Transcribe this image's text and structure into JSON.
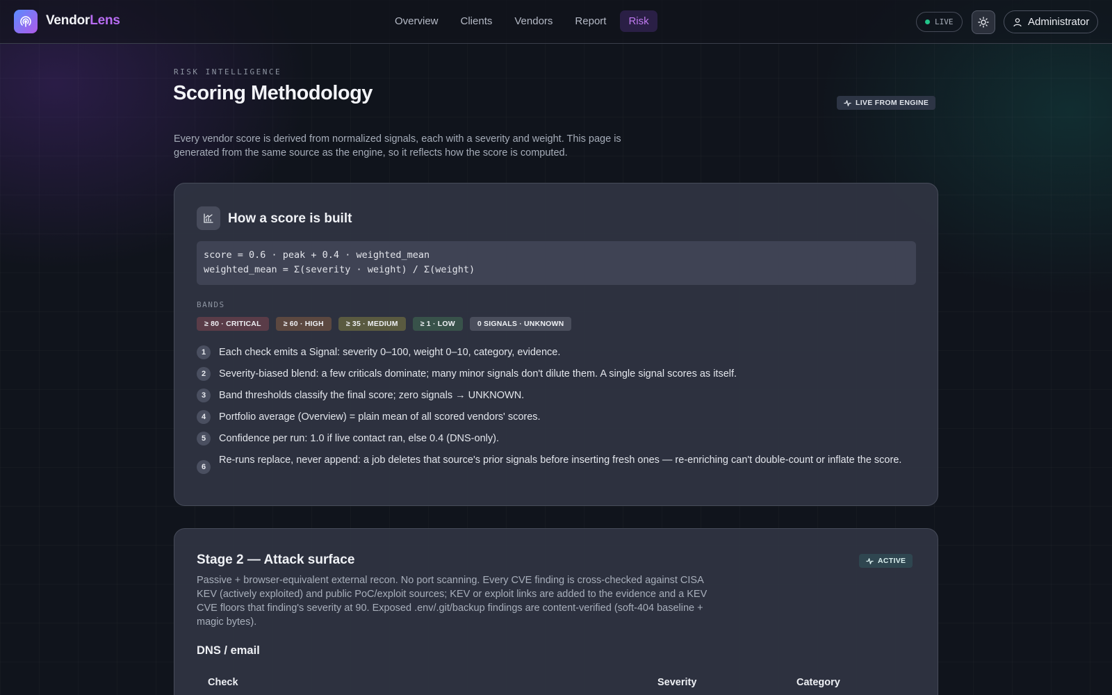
{
  "nav": {
    "brand_main": "Vendor",
    "brand_accent": "Lens",
    "links": [
      "Overview",
      "Clients",
      "Vendors",
      "Report",
      "Risk"
    ],
    "active_link": "Risk",
    "live_label": "LIVE",
    "admin_label": "Administrator"
  },
  "header": {
    "eyebrow": "RISK INTELLIGENCE",
    "title": "Scoring Methodology",
    "badge": "LIVE FROM ENGINE",
    "intro": "Every vendor score is derived from normalized signals, each with a severity and weight. This page is generated from the same source as the engine, so it reflects how the score is computed."
  },
  "score_card": {
    "title": "How a score is built",
    "formula_line1": "score = 0.6 · peak + 0.4 · weighted_mean",
    "formula_line2": "weighted_mean = Σ(severity · weight) / Σ(weight)",
    "bands_label": "BANDS",
    "bands": [
      {
        "label": "≥ 80 · CRITICAL",
        "color": "#5a3c48"
      },
      {
        "label": "≥ 60 · HIGH",
        "color": "#5c4840"
      },
      {
        "label": "≥ 35 · MEDIUM",
        "color": "#5a5a40"
      },
      {
        "label": "≥ 1 · LOW",
        "color": "#38524a"
      },
      {
        "label": "0 SIGNALS · UNKNOWN",
        "color": "#4a4e5c"
      }
    ],
    "steps": [
      "Each check emits a Signal: severity 0–100, weight 0–10, category, evidence.",
      "Severity-biased blend: a few criticals dominate; many minor signals don't dilute them. A single signal scores as itself.",
      "Band thresholds classify the final score; zero signals → UNKNOWN.",
      "Portfolio average (Overview) = plain mean of all scored vendors' scores.",
      "Confidence per run: 1.0 if live contact ran, else 0.4 (DNS-only).",
      "Re-runs replace, never append: a job deletes that source's prior signals before inserting fresh ones — re-enriching can't double-count or inflate the score."
    ]
  },
  "stage2": {
    "title": "Stage 2 — Attack surface",
    "badge": "ACTIVE",
    "description": "Passive + browser-equivalent external recon. No port scanning. Every CVE finding is cross-checked against CISA KEV (actively exploited) and public PoC/exploit sources; KEV or exploit links are added to the evidence and a KEV CVE floors that finding's severity at 90. Exposed .env/.git/backup findings are content-verified (soft-404 baseline + magic bytes).",
    "section_title": "DNS / email",
    "columns": [
      "Check",
      "Severity",
      "Category"
    ]
  },
  "colors": {
    "accent_purple": "#b86cf2",
    "live_green": "#22c48a"
  }
}
